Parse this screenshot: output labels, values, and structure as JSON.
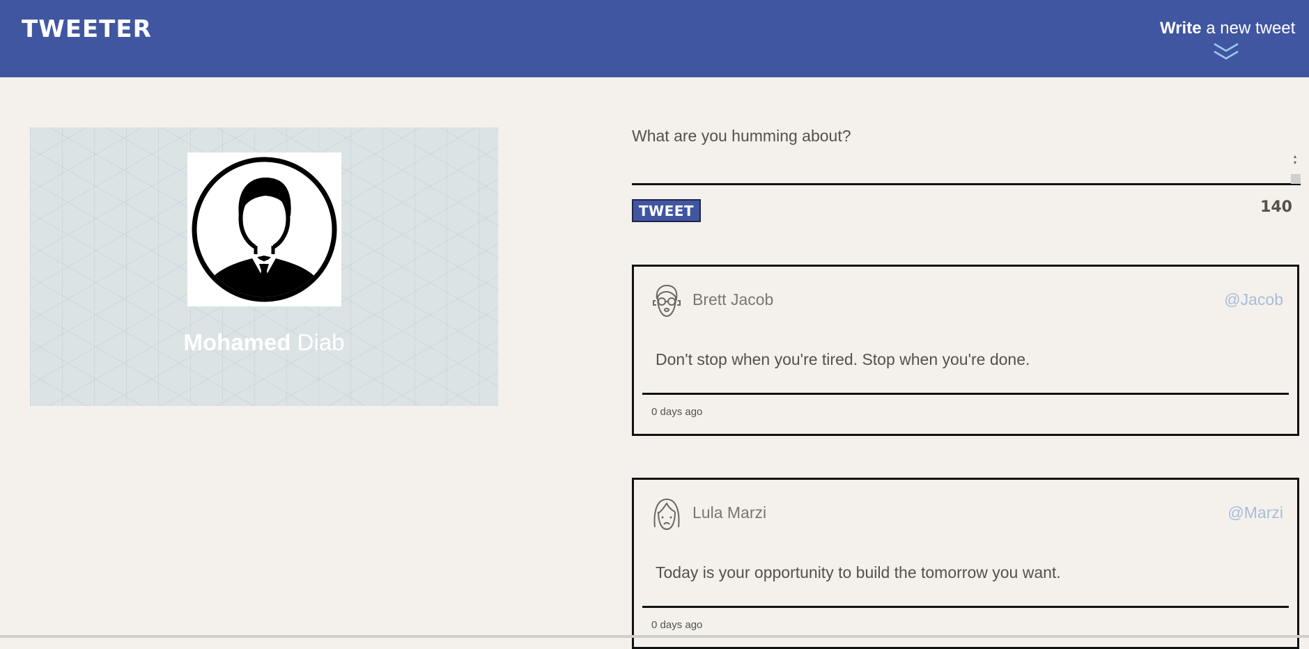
{
  "header": {
    "logo": "TWEETER",
    "compose_toggle": {
      "bold": "Write",
      "rest": " a new tweet"
    }
  },
  "profile": {
    "first_name": "Mohamed",
    "last_name": " Diab",
    "avatar_icon": "user-avatar-icon"
  },
  "composer": {
    "placeholder": "What are you humming about?",
    "value": "",
    "button_label": "TWEET",
    "char_count": "140"
  },
  "tweets": [
    {
      "name": "Brett Jacob",
      "handle": "@Jacob",
      "text": "Don't stop when you're tired. Stop when you're done.",
      "timestamp": "0 days ago",
      "avatar_icon": "man-avatar-icon"
    },
    {
      "name": "Lula Marzi",
      "handle": "@Marzi",
      "text": "Today is your opportunity to build the tomorrow you want.",
      "timestamp": "0 days ago",
      "avatar_icon": "woman-avatar-icon"
    }
  ],
  "colors": {
    "nav": "#4056a1",
    "background": "#f4f1ec",
    "text": "#545149",
    "handle": "#a9bbd8"
  }
}
